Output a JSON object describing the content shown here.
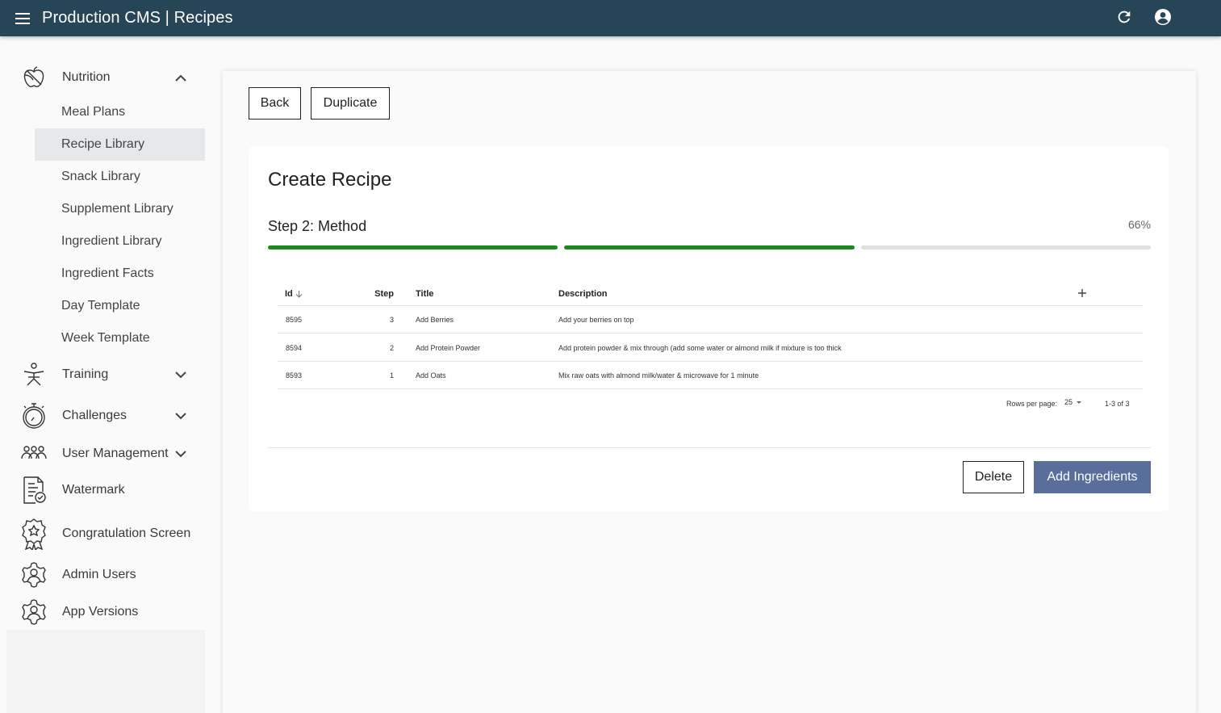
{
  "header": {
    "title": "Production CMS | Recipes"
  },
  "sidebar": {
    "sections": [
      {
        "label": "Nutrition",
        "icon": "apple-icon",
        "expanded": true
      },
      {
        "label": "Training",
        "icon": "stretching-person-icon",
        "expanded": false
      },
      {
        "label": "Challenges",
        "icon": "stopwatch-icon",
        "expanded": false
      },
      {
        "label": "User Management",
        "icon": "users-group-icon",
        "expanded": false
      },
      {
        "label": "Watermark",
        "icon": "document-check-icon"
      },
      {
        "label": "Congratulation Screen",
        "icon": "award-badge-icon"
      },
      {
        "label": "Admin Users",
        "icon": "admin-gear-icon"
      },
      {
        "label": "App Versions",
        "icon": "versions-gear-icon"
      }
    ],
    "nutrition_items": [
      {
        "label": "Meal Plans"
      },
      {
        "label": "Recipe Library",
        "active": true
      },
      {
        "label": "Snack Library"
      },
      {
        "label": "Supplement Library"
      },
      {
        "label": "Ingredient Library"
      },
      {
        "label": "Ingredient Facts"
      },
      {
        "label": "Day Template"
      },
      {
        "label": "Week Template"
      }
    ]
  },
  "toolbar": {
    "back_label": "Back",
    "duplicate_label": "Duplicate"
  },
  "form": {
    "title": "Create Recipe",
    "step_label": "Step 2: Method",
    "progress_percent": "66%",
    "progress_steps_done": 2,
    "progress_steps_total": 3,
    "progress_color": "#1a8a1a"
  },
  "table": {
    "columns": {
      "id": "Id",
      "step": "Step",
      "title": "Title",
      "description": "Description"
    },
    "rows": [
      {
        "id": "8595",
        "step": "3",
        "title": "Add Berries",
        "description": "Add your berries on top"
      },
      {
        "id": "8594",
        "step": "2",
        "title": "Add Protein Powder",
        "description": "Add protein powder & mix through (add some water or almond milk if mixture is too thick"
      },
      {
        "id": "8593",
        "step": "1",
        "title": "Add Oats",
        "description": "Mix raw oats with almond milk/water & microwave for 1 minute"
      }
    ],
    "rows_per_page_label": "Rows per page:",
    "rows_per_page_value": "25",
    "range_label": "1-3 of 3"
  },
  "actions": {
    "delete_label": "Delete",
    "add_ingredients_label": "Add Ingredients"
  },
  "colors": {
    "topbar": "#264556",
    "primary_button": "#5a6e9c",
    "progress_done": "#1a8a1a",
    "progress_todo": "#e0e0e0"
  }
}
